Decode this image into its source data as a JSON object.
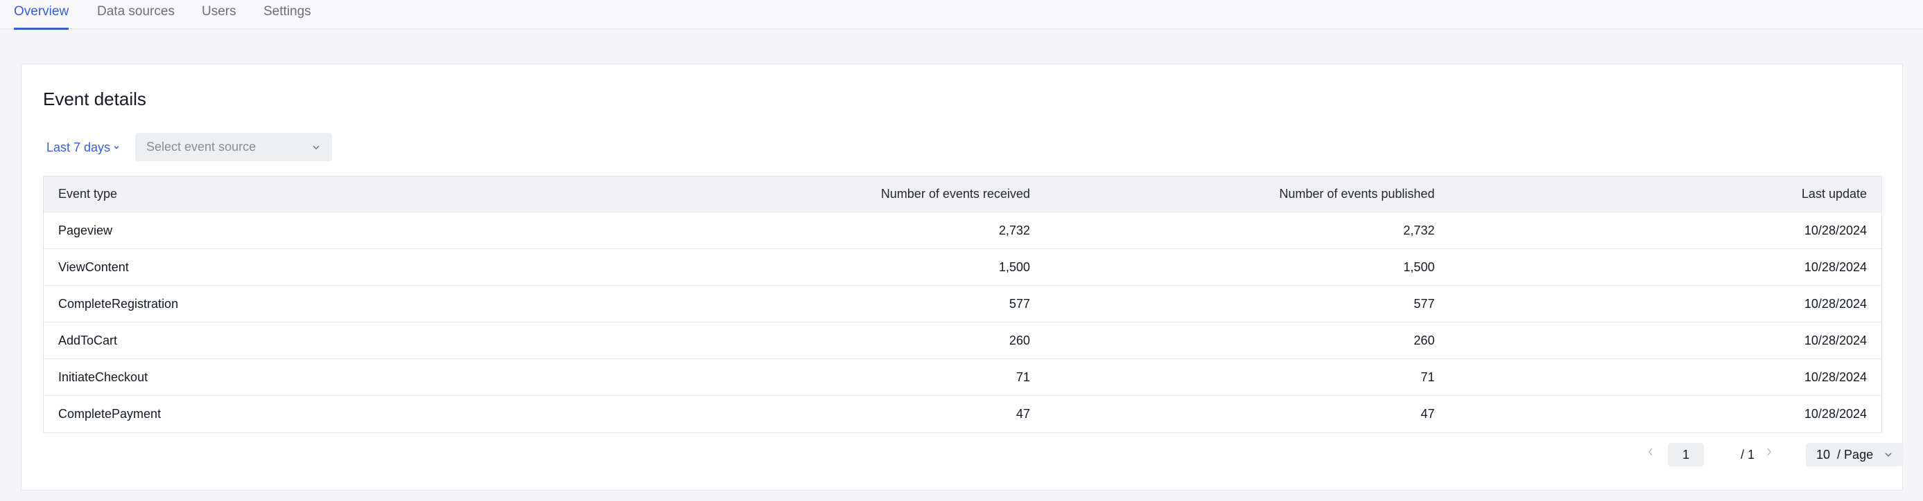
{
  "tabs": [
    {
      "label": "Overview",
      "active": true
    },
    {
      "label": "Data sources",
      "active": false
    },
    {
      "label": "Users",
      "active": false
    },
    {
      "label": "Settings",
      "active": false
    }
  ],
  "card": {
    "title": "Event details",
    "filters": {
      "date_range": "Last 7 days",
      "event_source_placeholder": "Select event source"
    }
  },
  "table": {
    "columns": [
      "Event type",
      "Number of events received",
      "Number of events published",
      "Last update"
    ],
    "rows": [
      [
        "Pageview",
        "2,732",
        "2,732",
        "10/28/2024"
      ],
      [
        "ViewContent",
        "1,500",
        "1,500",
        "10/28/2024"
      ],
      [
        "CompleteRegistration",
        "577",
        "577",
        "10/28/2024"
      ],
      [
        "AddToCart",
        "260",
        "260",
        "10/28/2024"
      ],
      [
        "InitiateCheckout",
        "71",
        "71",
        "10/28/2024"
      ],
      [
        "CompletePayment",
        "47",
        "47",
        "10/28/2024"
      ]
    ]
  },
  "pagination": {
    "current_page": "1",
    "total": "/ 1",
    "page_size": "10",
    "page_size_suffix": "/ Page"
  },
  "colors": {
    "accent": "#3b5ccc",
    "header_bg": "#f2f2f5",
    "page_bg": "#f5f5f7"
  }
}
